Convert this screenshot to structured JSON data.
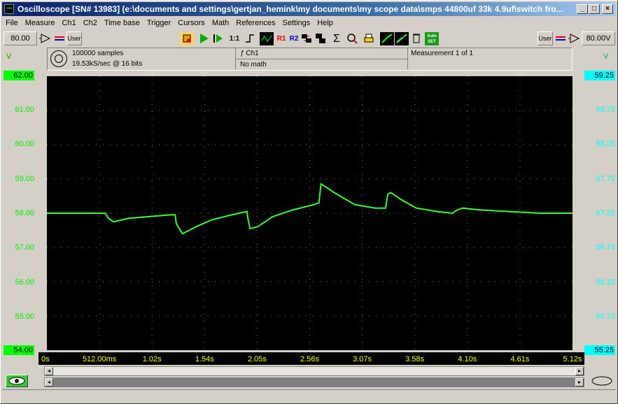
{
  "window": {
    "title": "Oscilloscope  [SN# 13983]  (e:\\documents and settings\\gertjan_hemink\\my documents\\my scope data\\smps 44800uf 33k 4.9uf\\switch fro...",
    "minimize": "_",
    "maximize": "□",
    "close": "×"
  },
  "menu": [
    "File",
    "Measure",
    "Ch1",
    "Ch2",
    "Time base",
    "Trigger",
    "Cursors",
    "Math",
    "References",
    "Settings",
    "Help"
  ],
  "toolbar": {
    "left_range": "80.00",
    "left_user": "User",
    "right_user": "User",
    "right_range": "80.00V",
    "r1": "R1",
    "r2": "R2",
    "auto_set": "Auto SET",
    "one_to_one": "1:1"
  },
  "info": {
    "samples": "100000 samples",
    "rate": "19.53kS/sec @ 16 bits",
    "channel": "Ch1",
    "math": "No math",
    "measurement": "Measurement 1 of 1"
  },
  "axes": {
    "left_unit": "V",
    "right_unit": "V",
    "left_ticks": [
      "62.00",
      "61.00",
      "60.00",
      "59.00",
      "58.00",
      "57.00",
      "56.00",
      "55.00",
      "54.00"
    ],
    "right_ticks": [
      "59.25",
      "58.75",
      "58.25",
      "57.75",
      "57.25",
      "56.75",
      "56.25",
      "55.75",
      "55.25"
    ],
    "x_ticks": [
      "0s",
      "512.00ms",
      "1.02s",
      "1.54s",
      "2.05s",
      "2.56s",
      "3.07s",
      "3.58s",
      "4.10s",
      "4.61s",
      "5.12s"
    ]
  },
  "colors": {
    "trace": "#33ff33",
    "left_axis": "#00ee00",
    "right_axis": "#00ffff",
    "x_axis": "#ffff00"
  },
  "chart_data": {
    "type": "line",
    "title": "",
    "xlabel": "",
    "ylabel": "V",
    "xlim": [
      0,
      5.12
    ],
    "ylim": [
      54,
      62
    ],
    "grid": true,
    "series": [
      {
        "x": [
          0,
          0.57,
          0.6,
          0.65,
          0.8,
          1.0,
          1.2,
          1.25,
          1.26,
          1.32,
          1.45,
          1.6,
          1.8,
          1.95,
          1.96,
          1.98,
          2.05,
          2.2,
          2.4,
          2.6,
          2.65,
          2.67,
          2.7,
          2.8,
          3.0,
          3.2,
          3.3,
          3.32,
          3.35,
          3.45,
          3.6,
          3.8,
          3.95,
          4.0,
          4.05,
          4.2,
          4.5,
          4.8,
          5.12
        ],
        "y": [
          58.0,
          58.0,
          57.85,
          57.75,
          57.85,
          57.9,
          57.95,
          57.95,
          57.7,
          57.4,
          57.6,
          57.8,
          57.95,
          58.05,
          57.8,
          57.55,
          57.6,
          57.9,
          58.1,
          58.25,
          58.3,
          58.85,
          58.8,
          58.6,
          58.25,
          58.15,
          58.15,
          58.55,
          58.6,
          58.4,
          58.15,
          58.05,
          58.0,
          58.1,
          58.15,
          58.1,
          58.05,
          58.0,
          58.0
        ]
      }
    ]
  }
}
